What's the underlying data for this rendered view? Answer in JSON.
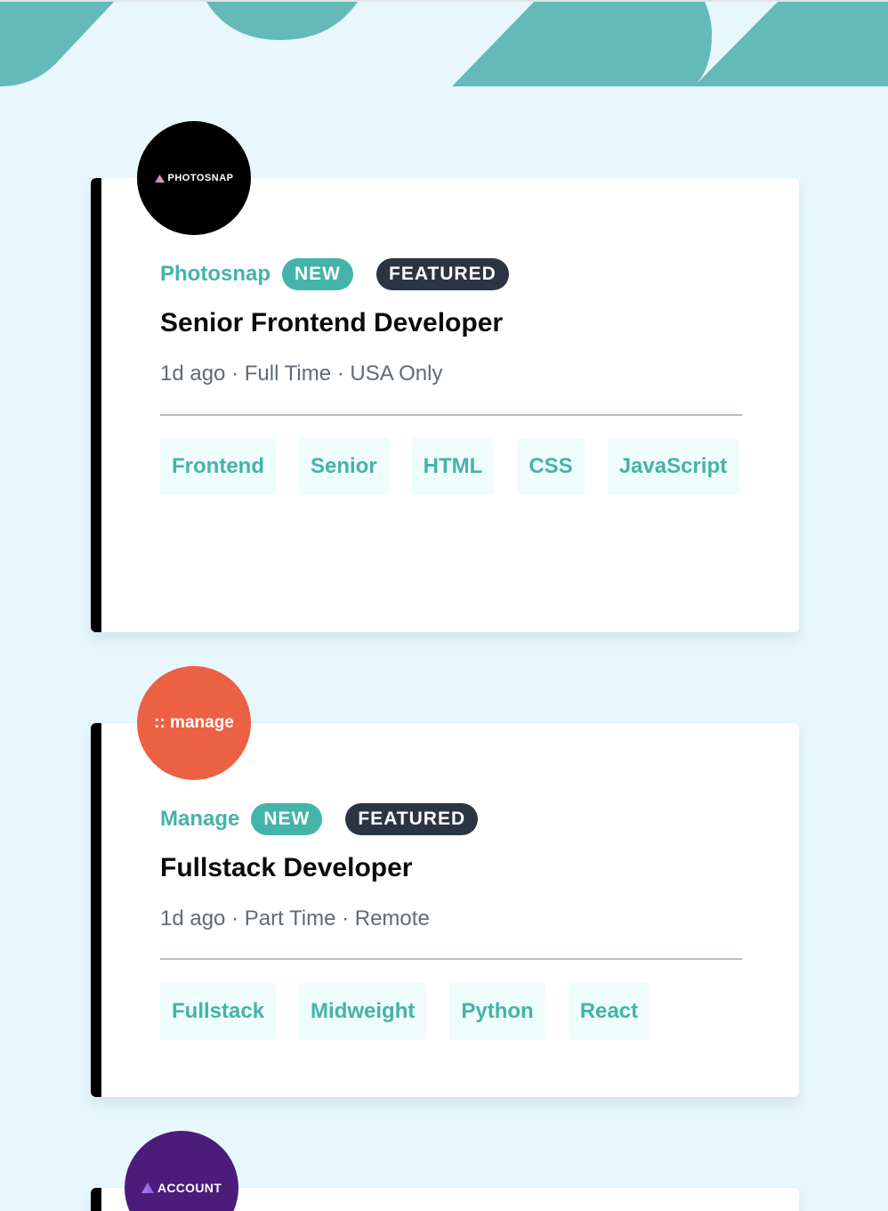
{
  "colors": {
    "page_background": "#e8f7fd",
    "accent_teal": "#44b3a8",
    "featured_dark": "#2b3443",
    "tag_background": "#eefcfb",
    "card_border_left": "#000000"
  },
  "jobs": [
    {
      "logo": {
        "text": "PHOTOSNAP",
        "icon": "triangle-gradient-icon",
        "color": "#000000"
      },
      "company": "Photosnap",
      "new_label": "NEW",
      "featured_label": "FEATURED",
      "position": "Senior Frontend Developer",
      "meta": "1d ago · Full Time · USA Only",
      "tags": [
        "Frontend",
        "Senior",
        "HTML",
        "CSS",
        "JavaScript"
      ]
    },
    {
      "logo": {
        "text": ":: manage",
        "icon": "dots-icon",
        "color": "#ec6043"
      },
      "company": "Manage",
      "new_label": "NEW",
      "featured_label": "FEATURED",
      "position": "Fullstack Developer",
      "meta": "1d ago · Part Time · Remote",
      "tags": [
        "Fullstack",
        "Midweight",
        "Python",
        "React"
      ]
    },
    {
      "logo": {
        "text": "ACCOUNT",
        "icon": "triangle-gradient-icon",
        "color": "#4b1c7c"
      }
    }
  ]
}
